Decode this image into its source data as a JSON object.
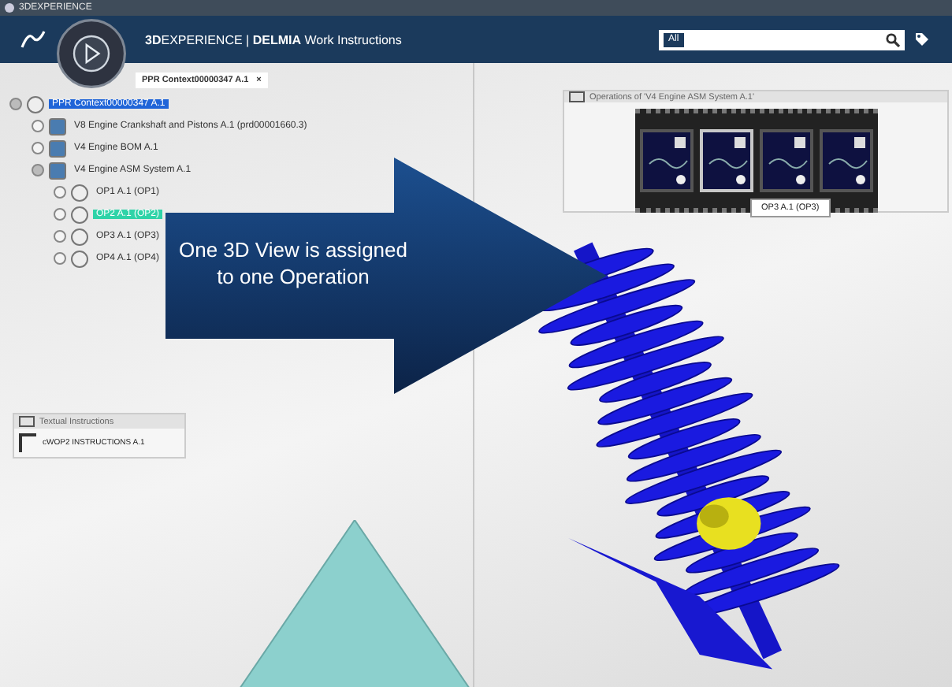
{
  "window": {
    "title": "3DEXPERIENCE"
  },
  "header": {
    "brand": "**3D**EXPERIENCE | **DELMIA** Work Instructions",
    "search": {
      "scope": "All"
    }
  },
  "tab": {
    "label": "PPR Context00000347 A.1",
    "close": "×"
  },
  "tree": [
    {
      "label": "PPR Context00000347 A.1",
      "selected": true,
      "color": "#1f64d8",
      "expanded": true,
      "children": [
        {
          "label": "V8 Engine Crankshaft and Pistons A.1 (prd00001660.3)",
          "selected": false,
          "expanded": false
        },
        {
          "label": "V4 Engine BOM A.1",
          "selected": false,
          "expanded": false
        },
        {
          "label": "V4 Engine ASM System A.1",
          "selected": false,
          "expanded": true,
          "children": [
            {
              "label": "OP1 A.1 (OP1)",
              "selected": false,
              "expanded": false
            },
            {
              "label": "OP2 A.1 (OP2)",
              "selected": true,
              "color": "#2fd3a8",
              "expanded": false
            },
            {
              "label": "OP3 A.1 (OP3)",
              "selected": false,
              "expanded": false
            },
            {
              "label": "OP4 A.1 (OP4)",
              "selected": false,
              "expanded": false
            }
          ]
        }
      ]
    }
  ],
  "operations": {
    "title": "Operations of 'V4 Engine ASM System A.1'",
    "thumbnails": [
      {
        "selected": false
      },
      {
        "selected": true
      },
      {
        "selected": false
      },
      {
        "selected": false
      }
    ],
    "tooltip": "OP3 A.1 (OP3)"
  },
  "callout": "One 3D View is assigned to one Operation",
  "textual_instructions": {
    "title": "Textual Instructions",
    "items": [
      "cWOP2 INSTRUCTIONS A.1"
    ]
  }
}
